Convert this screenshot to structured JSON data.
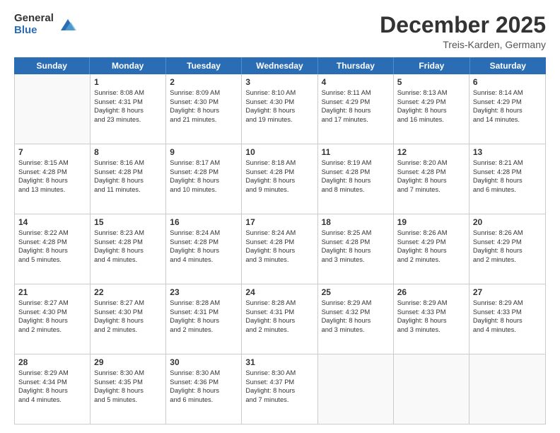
{
  "logo": {
    "general": "General",
    "blue": "Blue"
  },
  "header": {
    "title": "December 2025",
    "subtitle": "Treis-Karden, Germany"
  },
  "weekdays": [
    "Sunday",
    "Monday",
    "Tuesday",
    "Wednesday",
    "Thursday",
    "Friday",
    "Saturday"
  ],
  "weeks": [
    [
      {
        "day": "",
        "lines": []
      },
      {
        "day": "1",
        "lines": [
          "Sunrise: 8:08 AM",
          "Sunset: 4:31 PM",
          "Daylight: 8 hours",
          "and 23 minutes."
        ]
      },
      {
        "day": "2",
        "lines": [
          "Sunrise: 8:09 AM",
          "Sunset: 4:30 PM",
          "Daylight: 8 hours",
          "and 21 minutes."
        ]
      },
      {
        "day": "3",
        "lines": [
          "Sunrise: 8:10 AM",
          "Sunset: 4:30 PM",
          "Daylight: 8 hours",
          "and 19 minutes."
        ]
      },
      {
        "day": "4",
        "lines": [
          "Sunrise: 8:11 AM",
          "Sunset: 4:29 PM",
          "Daylight: 8 hours",
          "and 17 minutes."
        ]
      },
      {
        "day": "5",
        "lines": [
          "Sunrise: 8:13 AM",
          "Sunset: 4:29 PM",
          "Daylight: 8 hours",
          "and 16 minutes."
        ]
      },
      {
        "day": "6",
        "lines": [
          "Sunrise: 8:14 AM",
          "Sunset: 4:29 PM",
          "Daylight: 8 hours",
          "and 14 minutes."
        ]
      }
    ],
    [
      {
        "day": "7",
        "lines": [
          "Sunrise: 8:15 AM",
          "Sunset: 4:28 PM",
          "Daylight: 8 hours",
          "and 13 minutes."
        ]
      },
      {
        "day": "8",
        "lines": [
          "Sunrise: 8:16 AM",
          "Sunset: 4:28 PM",
          "Daylight: 8 hours",
          "and 11 minutes."
        ]
      },
      {
        "day": "9",
        "lines": [
          "Sunrise: 8:17 AM",
          "Sunset: 4:28 PM",
          "Daylight: 8 hours",
          "and 10 minutes."
        ]
      },
      {
        "day": "10",
        "lines": [
          "Sunrise: 8:18 AM",
          "Sunset: 4:28 PM",
          "Daylight: 8 hours",
          "and 9 minutes."
        ]
      },
      {
        "day": "11",
        "lines": [
          "Sunrise: 8:19 AM",
          "Sunset: 4:28 PM",
          "Daylight: 8 hours",
          "and 8 minutes."
        ]
      },
      {
        "day": "12",
        "lines": [
          "Sunrise: 8:20 AM",
          "Sunset: 4:28 PM",
          "Daylight: 8 hours",
          "and 7 minutes."
        ]
      },
      {
        "day": "13",
        "lines": [
          "Sunrise: 8:21 AM",
          "Sunset: 4:28 PM",
          "Daylight: 8 hours",
          "and 6 minutes."
        ]
      }
    ],
    [
      {
        "day": "14",
        "lines": [
          "Sunrise: 8:22 AM",
          "Sunset: 4:28 PM",
          "Daylight: 8 hours",
          "and 5 minutes."
        ]
      },
      {
        "day": "15",
        "lines": [
          "Sunrise: 8:23 AM",
          "Sunset: 4:28 PM",
          "Daylight: 8 hours",
          "and 4 minutes."
        ]
      },
      {
        "day": "16",
        "lines": [
          "Sunrise: 8:24 AM",
          "Sunset: 4:28 PM",
          "Daylight: 8 hours",
          "and 4 minutes."
        ]
      },
      {
        "day": "17",
        "lines": [
          "Sunrise: 8:24 AM",
          "Sunset: 4:28 PM",
          "Daylight: 8 hours",
          "and 3 minutes."
        ]
      },
      {
        "day": "18",
        "lines": [
          "Sunrise: 8:25 AM",
          "Sunset: 4:28 PM",
          "Daylight: 8 hours",
          "and 3 minutes."
        ]
      },
      {
        "day": "19",
        "lines": [
          "Sunrise: 8:26 AM",
          "Sunset: 4:29 PM",
          "Daylight: 8 hours",
          "and 2 minutes."
        ]
      },
      {
        "day": "20",
        "lines": [
          "Sunrise: 8:26 AM",
          "Sunset: 4:29 PM",
          "Daylight: 8 hours",
          "and 2 minutes."
        ]
      }
    ],
    [
      {
        "day": "21",
        "lines": [
          "Sunrise: 8:27 AM",
          "Sunset: 4:30 PM",
          "Daylight: 8 hours",
          "and 2 minutes."
        ]
      },
      {
        "day": "22",
        "lines": [
          "Sunrise: 8:27 AM",
          "Sunset: 4:30 PM",
          "Daylight: 8 hours",
          "and 2 minutes."
        ]
      },
      {
        "day": "23",
        "lines": [
          "Sunrise: 8:28 AM",
          "Sunset: 4:31 PM",
          "Daylight: 8 hours",
          "and 2 minutes."
        ]
      },
      {
        "day": "24",
        "lines": [
          "Sunrise: 8:28 AM",
          "Sunset: 4:31 PM",
          "Daylight: 8 hours",
          "and 2 minutes."
        ]
      },
      {
        "day": "25",
        "lines": [
          "Sunrise: 8:29 AM",
          "Sunset: 4:32 PM",
          "Daylight: 8 hours",
          "and 3 minutes."
        ]
      },
      {
        "day": "26",
        "lines": [
          "Sunrise: 8:29 AM",
          "Sunset: 4:33 PM",
          "Daylight: 8 hours",
          "and 3 minutes."
        ]
      },
      {
        "day": "27",
        "lines": [
          "Sunrise: 8:29 AM",
          "Sunset: 4:33 PM",
          "Daylight: 8 hours",
          "and 4 minutes."
        ]
      }
    ],
    [
      {
        "day": "28",
        "lines": [
          "Sunrise: 8:29 AM",
          "Sunset: 4:34 PM",
          "Daylight: 8 hours",
          "and 4 minutes."
        ]
      },
      {
        "day": "29",
        "lines": [
          "Sunrise: 8:30 AM",
          "Sunset: 4:35 PM",
          "Daylight: 8 hours",
          "and 5 minutes."
        ]
      },
      {
        "day": "30",
        "lines": [
          "Sunrise: 8:30 AM",
          "Sunset: 4:36 PM",
          "Daylight: 8 hours",
          "and 6 minutes."
        ]
      },
      {
        "day": "31",
        "lines": [
          "Sunrise: 8:30 AM",
          "Sunset: 4:37 PM",
          "Daylight: 8 hours",
          "and 7 minutes."
        ]
      },
      {
        "day": "",
        "lines": []
      },
      {
        "day": "",
        "lines": []
      },
      {
        "day": "",
        "lines": []
      }
    ]
  ]
}
